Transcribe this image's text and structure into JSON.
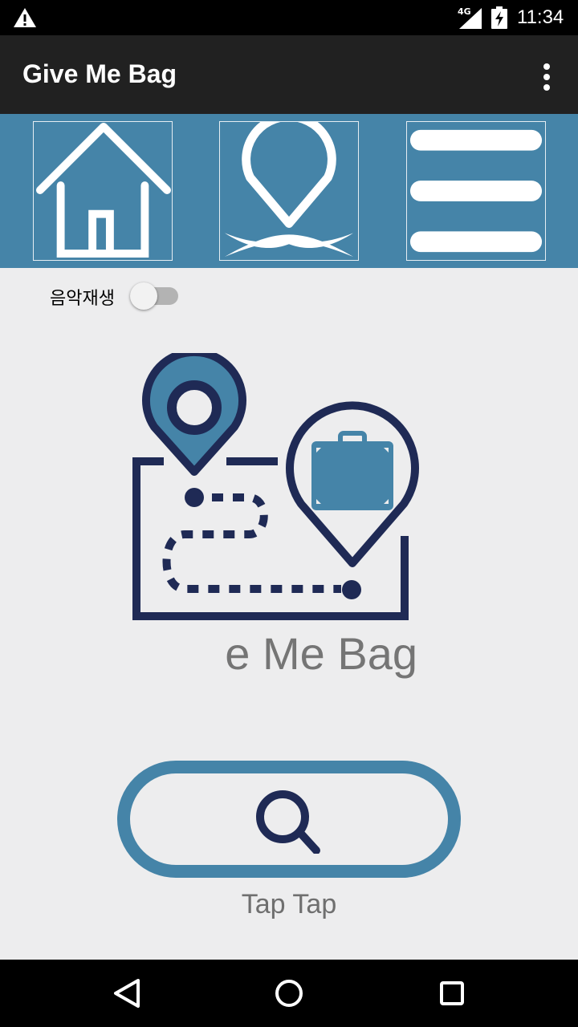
{
  "status_bar": {
    "network": "4G",
    "time": "11:34",
    "icons": [
      "warning-icon",
      "signal-icon",
      "battery-charging-icon"
    ]
  },
  "app_bar": {
    "title": "Give Me Bag",
    "menu_icon": "more-vert-icon"
  },
  "nav_tiles": [
    {
      "icon": "home-icon"
    },
    {
      "icon": "location-pin-icon"
    },
    {
      "icon": "menu-icon"
    }
  ],
  "music_toggle": {
    "label": "음악재생",
    "on": false
  },
  "logo": {
    "text": "e Me Bag",
    "icon": "map-route-luggage-icon"
  },
  "search_button": {
    "icon": "search-icon",
    "caption": "Tap Tap"
  },
  "system_nav": [
    "back-icon",
    "home-circle-icon",
    "recents-icon"
  ],
  "colors": {
    "accent": "#4584a8",
    "navy": "#1f2a55",
    "app_bar": "#212121",
    "background": "#ededee"
  }
}
